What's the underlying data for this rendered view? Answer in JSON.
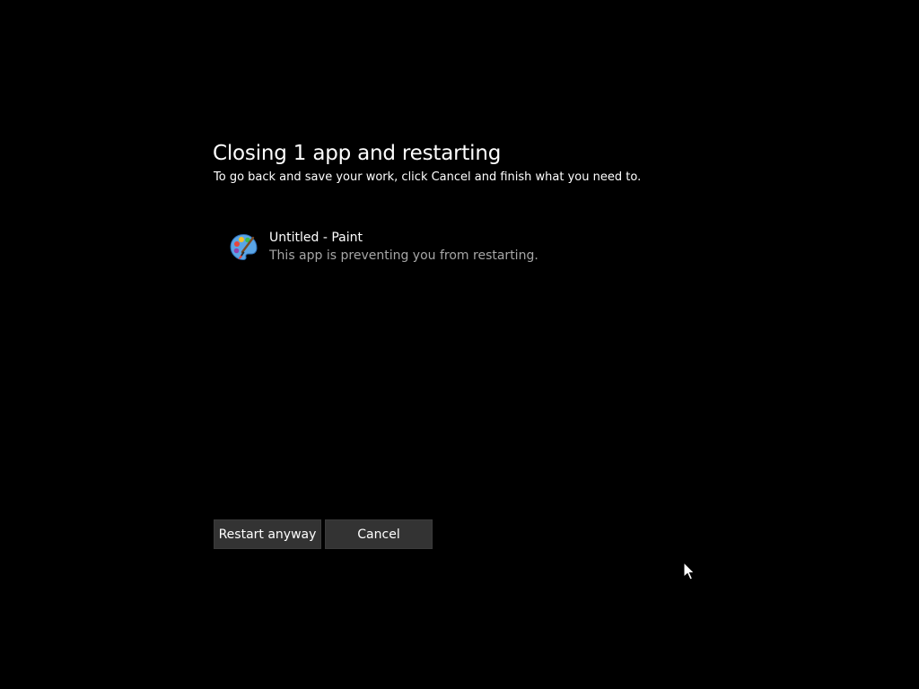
{
  "dialog": {
    "title": "Closing 1 app and restarting",
    "subtitle": "To go back and save your work, click Cancel and finish what you need to."
  },
  "apps": [
    {
      "name": "Untitled - Paint",
      "description": "This app is preventing you from restarting.",
      "icon": "paint-palette-icon"
    }
  ],
  "buttons": {
    "restart_label": "Restart anyway",
    "cancel_label": "Cancel"
  },
  "colors": {
    "background": "#000000",
    "button_bg": "#333333",
    "secondary_text": "#a6a6a6"
  }
}
